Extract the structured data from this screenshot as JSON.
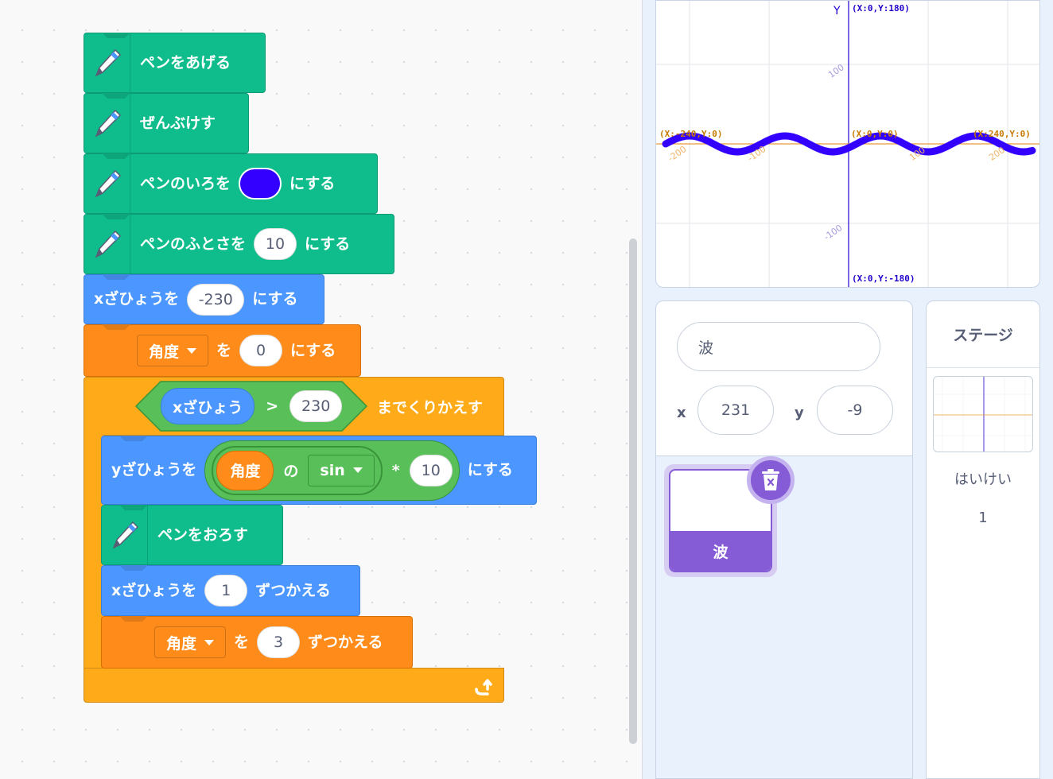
{
  "blocks": {
    "pen_up": "ペンをあげる",
    "clear": "ぜんぶけす",
    "set_color_pre": "ペンのいろを",
    "set_color_post": "にする",
    "pen_color": "#3300ff",
    "set_size_pre": "ペンのふとさを",
    "set_size_value": "10",
    "set_size_post": "にする",
    "set_x_pre": "xざひょうを",
    "set_x_value": "-230",
    "set_x_post": "にする",
    "set_var_dropdown": "角度",
    "set_var_mid": "を",
    "set_var_value": "0",
    "set_var_post": "にする",
    "repeat_reporter": "xざひょう",
    "repeat_op": ">",
    "repeat_value": "230",
    "repeat_post": "までくりかえす",
    "set_y_pre": "yざひょうを",
    "set_y_var": "角度",
    "set_y_of": "の",
    "set_y_func": "sin",
    "set_y_mul": "*",
    "set_y_mul_value": "10",
    "set_y_post": "にする",
    "pen_down": "ペンをおろす",
    "change_x_pre": "xざひょうを",
    "change_x_value": "1",
    "change_x_post": "ずつかえる",
    "change_var_dropdown": "角度",
    "change_var_mid": "を",
    "change_var_value": "3",
    "change_var_post": "ずつかえる"
  },
  "stage": {
    "y_axis_label": "Y",
    "top_label": "(X:0,Y:180)",
    "bottom_label": "(X:0,Y:-180)",
    "left_label": "(X:-240,Y:0)",
    "right_label": "(X:240,Y:0)",
    "center_label": "(X:0,Y:0)",
    "tick_y_pos": "100",
    "tick_y_neg": "-100",
    "tick_x_neg200": "-200",
    "tick_x_neg100": "-100",
    "tick_x_100": "100",
    "tick_x_200": "200",
    "line_color": "#3300ff"
  },
  "sprite_info": {
    "name": "波",
    "x_label": "x",
    "x_value": "231",
    "y_label": "y",
    "y_value": "-9"
  },
  "sprite_list": {
    "selected_name": "波"
  },
  "stage_pane": {
    "title": "ステージ",
    "backdrop_label": "はいけい",
    "backdrop_count": "1"
  }
}
